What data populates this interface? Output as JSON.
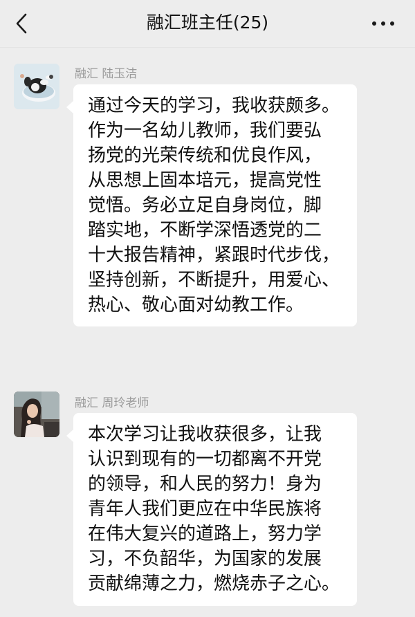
{
  "header": {
    "title": "融汇班主任(25)",
    "back_icon": "chevron-left-icon",
    "more_icon": "ellipsis-icon"
  },
  "messages": [
    {
      "sender": "融汇 陆玉洁",
      "avatar": "cartoon-dog-avatar",
      "text": "通过今天的学习，我收获颇多。\n作为一名幼儿教师，我们要弘\n扬党的光荣传统和优良作风，\n从思想上固本培元，提高党性\n觉悟。务必立足自身岗位，脚\n踏实地，不断学深悟透党的二\n十大报告精神，紧跟时代步伐，\n坚持创新，不断提升，用爱心、\n热心、敬心面对幼教工作。"
    },
    {
      "sender": "融汇 周玲老师",
      "avatar": "photo-avatar",
      "text": "本次学习让我收获很多，让我\n认识到现有的一切都离不开党\n的领导，和人民的努力！身为\n青年人我们更应在中华民族将\n在伟大复兴的道路上，努力学\n习，不负韶华，为国家的发展\n贡献绵薄之力，燃烧赤子之心。"
    }
  ]
}
